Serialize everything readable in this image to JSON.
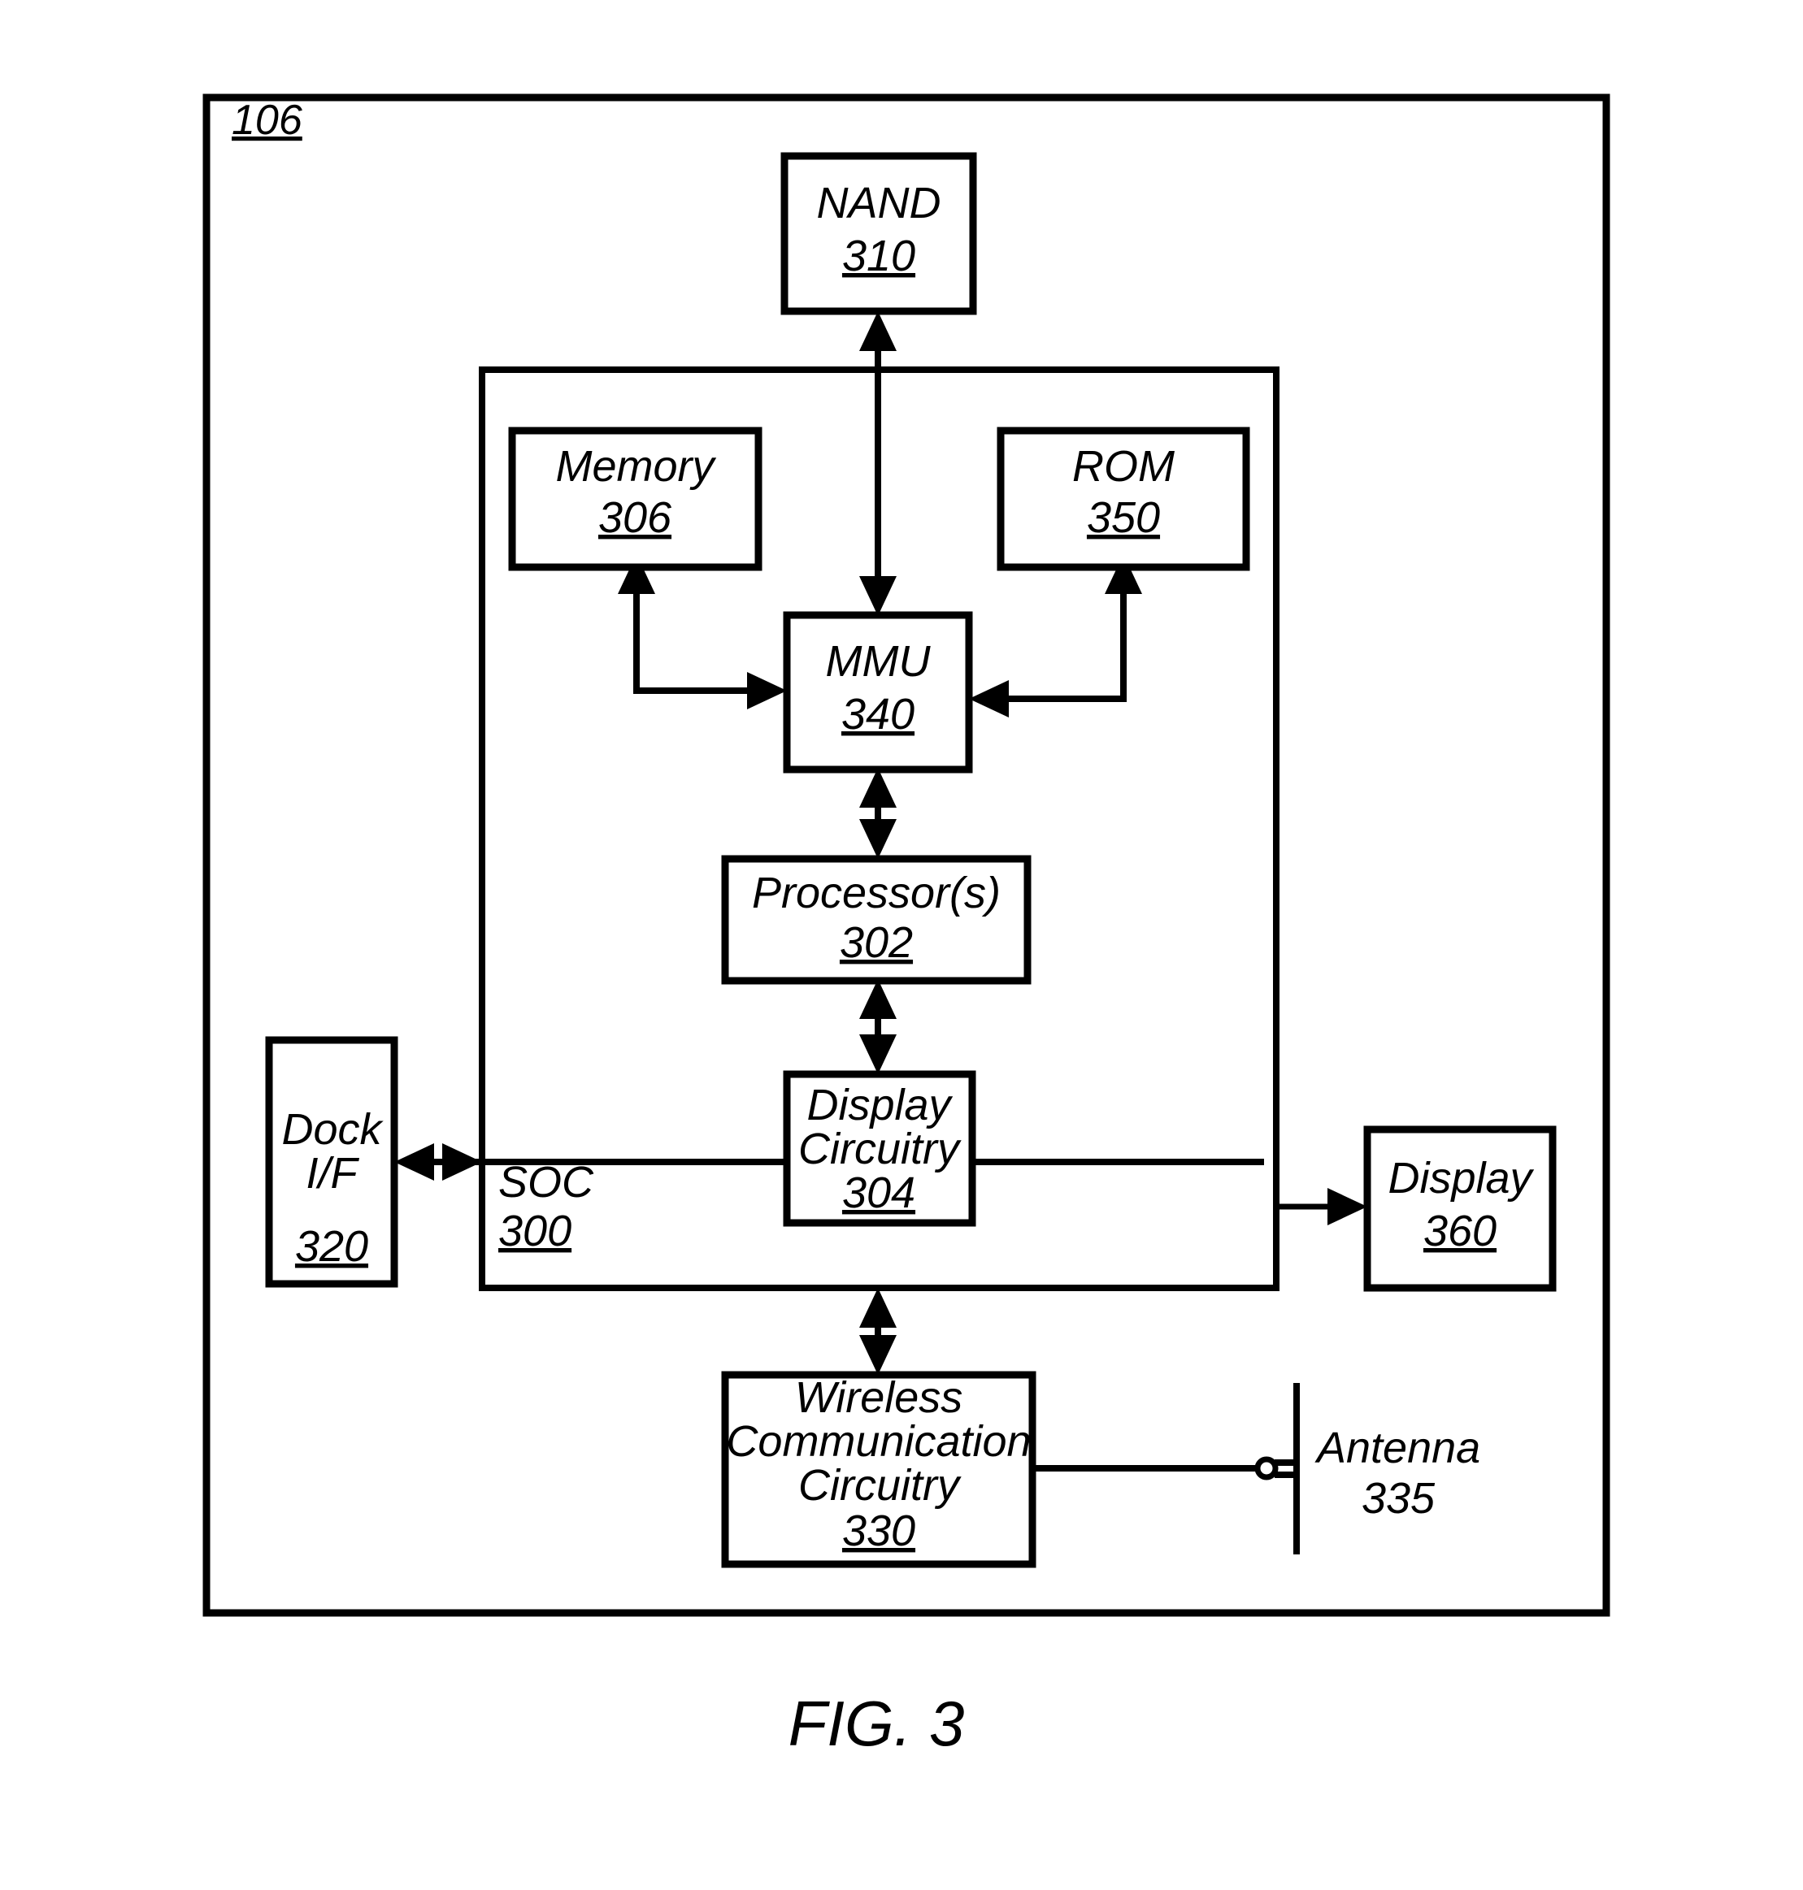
{
  "figure": {
    "caption": "FIG. 3",
    "outer_ref": "106",
    "line_color": "#000000",
    "background": "#ffffff"
  },
  "blocks": {
    "nand": {
      "label": "NAND",
      "ref": "310"
    },
    "memory": {
      "label": "Memory",
      "ref": "306"
    },
    "rom": {
      "label": "ROM",
      "ref": "350"
    },
    "mmu": {
      "label": "MMU",
      "ref": "340"
    },
    "processor": {
      "label": "Processor(s)",
      "ref": "302"
    },
    "display_circuitry": {
      "label_line1": "Display",
      "label_line2": "Circuitry",
      "ref": "304"
    },
    "dock": {
      "label_line1": "Dock",
      "label_line2": "I/F",
      "ref": "320"
    },
    "soc": {
      "label": "SOC",
      "ref": "300"
    },
    "display": {
      "label": "Display",
      "ref": "360"
    },
    "wireless": {
      "label_line1": "Wireless",
      "label_line2": "Communication",
      "label_line3": "Circuitry",
      "ref": "330"
    },
    "antenna": {
      "label": "Antenna",
      "ref": "335"
    }
  },
  "connections": [
    {
      "name": "nand-mmu",
      "from": "nand",
      "to": "mmu",
      "arrow": "both"
    },
    {
      "name": "memory-mmu",
      "from": "memory",
      "to": "mmu",
      "arrow": "both"
    },
    {
      "name": "rom-mmu",
      "from": "rom",
      "to": "mmu",
      "arrow": "both"
    },
    {
      "name": "mmu-processor",
      "from": "mmu",
      "to": "processor",
      "arrow": "both"
    },
    {
      "name": "processor-display-circuitry",
      "from": "processor",
      "to": "display_circuitry",
      "arrow": "both"
    },
    {
      "name": "dock-soc",
      "from": "dock",
      "to": "soc",
      "arrow": "both"
    },
    {
      "name": "soc-display",
      "from": "soc",
      "to": "display",
      "arrow": "single"
    },
    {
      "name": "soc-wireless",
      "from": "soc",
      "to": "wireless",
      "arrow": "both"
    },
    {
      "name": "wireless-antenna",
      "from": "wireless",
      "to": "antenna",
      "arrow": "none"
    }
  ]
}
